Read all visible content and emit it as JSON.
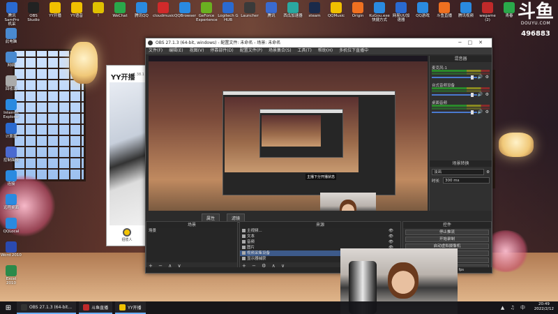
{
  "desktop_icons_top": [
    {
      "label": "腾讯SamPro",
      "sub": "机采",
      "color": "#2a6ad0"
    },
    {
      "label": "OBS Studio",
      "sub": "",
      "color": "#222"
    },
    {
      "label": "YY开播",
      "sub": "",
      "color": "#f0c000"
    },
    {
      "label": "YY语音",
      "sub": "",
      "color": "#f0c000"
    },
    {
      "label": "!",
      "sub": "",
      "color": "#e0c000"
    },
    {
      "label": "WeChat",
      "sub": "",
      "color": "#2aa84a"
    },
    {
      "label": "腾讯QQ",
      "sub": "",
      "color": "#2a8ae0"
    },
    {
      "label": "cloudmusic",
      "sub": "",
      "color": "#d02a2a"
    },
    {
      "label": "QQBrowser",
      "sub": "",
      "color": "#2a8ae0"
    },
    {
      "label": "GeForce",
      "sub": "Experience",
      "color": "#6ab020"
    },
    {
      "label": "Logitech G",
      "sub": "HUB",
      "color": "#2a6ad0"
    },
    {
      "label": "Launcher",
      "sub": "",
      "color": "#3a3a3a"
    },
    {
      "label": "腾讯",
      "sub": "",
      "color": "#3a6ad0"
    },
    {
      "label": "西瓜加速器",
      "sub": "",
      "color": "#2aa8a0"
    },
    {
      "label": "steam",
      "sub": "",
      "color": "#1a2a4a"
    },
    {
      "label": "QQMusic",
      "sub": "",
      "color": "#f0c000"
    },
    {
      "label": "Origin",
      "sub": "",
      "color": "#f07020"
    },
    {
      "label": "KuGou.exe",
      "sub": "快捷方式",
      "color": "#2a8ae0"
    },
    {
      "label": "网易UU加速器",
      "sub": "",
      "color": "#2a6ad0"
    },
    {
      "label": "QQ游戏",
      "sub": "",
      "color": "#2a8ae0"
    },
    {
      "label": "斗鱼直播",
      "sub": "",
      "color": "#f07020"
    },
    {
      "label": "腾讯视频",
      "sub": "",
      "color": "#2a8ae0"
    },
    {
      "label": "wegame (2)",
      "sub": "",
      "color": "#c02a2a"
    },
    {
      "label": "青春",
      "sub": "",
      "color": "#2aa84a"
    }
  ],
  "desktop_icons_left": [
    {
      "label": "此电脑",
      "color": "#4a8ad0"
    },
    {
      "label": "网络",
      "color": "#4a8ad0"
    },
    {
      "label": "回收站",
      "color": "#aaaaaa"
    },
    {
      "label": "Internet Explorer",
      "color": "#2a8ae0"
    },
    {
      "label": "计算器",
      "color": "#2a6ad0"
    },
    {
      "label": "控制面板",
      "color": "#4a6ad0"
    },
    {
      "label": "连接",
      "color": "#2a8ae0"
    },
    {
      "label": "远程桌面",
      "color": "#2a8ae0"
    },
    {
      "label": "QQLocal",
      "color": "#2a8ae0"
    },
    {
      "label": "Word 2010",
      "color": "#2a4ab0"
    },
    {
      "label": "Excel 2010",
      "color": "#2a8a4a"
    }
  ],
  "watermark": {
    "logo": "斗鱼",
    "url": "DOUYU.COM",
    "room": "496883"
  },
  "yy": {
    "logo": "YY开播",
    "version": "1.38.1",
    "button": "招揽人"
  },
  "obs": {
    "title": "OBS 27.1.3 (64-bit, windows) - 配置文件: 未命名 - 场景: 未命名",
    "menu": [
      "文件(F)",
      "编辑(E)",
      "视图(V)",
      "停靠部件(D)",
      "配置文件(P)",
      "场景集合(S)",
      "工具(T)",
      "帮助(H)",
      "多机位下直播中"
    ],
    "nested_tip": "主播下分开播状态",
    "mixer_header": "混音器",
    "channels": [
      {
        "name": "麦克风-1",
        "volume": 0.82
      },
      {
        "name": "台式音频设备",
        "volume": 0.82
      },
      {
        "name": "桌面音频",
        "volume": 0.82
      }
    ],
    "transition": {
      "header": "场景转换",
      "type": "淡出",
      "duration_label": "时长",
      "duration": "300 ms"
    },
    "tabs": [
      "属性",
      "滤镜"
    ],
    "scenes_header": "场景",
    "scenes": [
      "场景"
    ],
    "sources_header": "来源",
    "sources": [
      "主视频...",
      "文本",
      "音频",
      "图片",
      "视频采集设备",
      "显示器捕获"
    ],
    "selected_source_index": 4,
    "controls_header": "控件",
    "controls": [
      "停止推流",
      "开始录制",
      "启动虚拟摄像机",
      "工作室模式",
      "设置",
      "退出"
    ],
    "status": "LIVE: 00:00:00   REC: 00:00:00   CPU: 3.8%, 60.00 fps"
  },
  "taskbar": {
    "items": [
      {
        "label": "OBS 27.1.3 (64-bit...",
        "color": "#333"
      },
      {
        "label": "斗鱼直播",
        "color": "#c02a2a"
      },
      {
        "label": "YY开播",
        "color": "#f0c000"
      }
    ],
    "time": "20:49",
    "date": "2022/2/12"
  }
}
